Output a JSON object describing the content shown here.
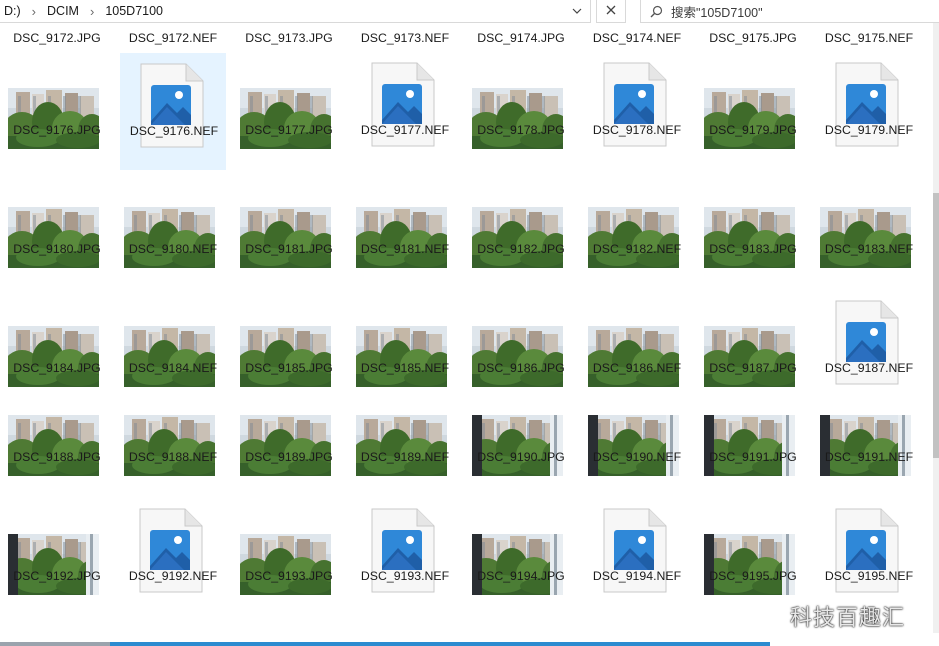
{
  "address": {
    "crumbs": [
      "D:)",
      "DCIM",
      "105D7100"
    ]
  },
  "search": {
    "placeholder": "搜索\"105D7100\""
  },
  "files": [
    {
      "name": "DSC_9172.JPG",
      "kind": "label-only"
    },
    {
      "name": "DSC_9172.NEF",
      "kind": "label-only"
    },
    {
      "name": "DSC_9173.JPG",
      "kind": "label-only"
    },
    {
      "name": "DSC_9173.NEF",
      "kind": "label-only"
    },
    {
      "name": "DSC_9174.JPG",
      "kind": "label-only"
    },
    {
      "name": "DSC_9174.NEF",
      "kind": "label-only"
    },
    {
      "name": "DSC_9175.JPG",
      "kind": "label-only"
    },
    {
      "name": "DSC_9175.NEF",
      "kind": "label-only"
    },
    {
      "name": "DSC_9176.JPG",
      "kind": "photo",
      "scene": "trees"
    },
    {
      "name": "DSC_9176.NEF",
      "kind": "nef",
      "selected": true
    },
    {
      "name": "DSC_9177.JPG",
      "kind": "photo",
      "scene": "trees"
    },
    {
      "name": "DSC_9177.NEF",
      "kind": "nef"
    },
    {
      "name": "DSC_9178.JPG",
      "kind": "photo",
      "scene": "trees"
    },
    {
      "name": "DSC_9178.NEF",
      "kind": "nef"
    },
    {
      "name": "DSC_9179.JPG",
      "kind": "photo",
      "scene": "trees"
    },
    {
      "name": "DSC_9179.NEF",
      "kind": "nef"
    },
    {
      "name": "DSC_9180.JPG",
      "kind": "photo",
      "scene": "trees"
    },
    {
      "name": "DSC_9180.NEF",
      "kind": "photo",
      "scene": "trees"
    },
    {
      "name": "DSC_9181.JPG",
      "kind": "photo",
      "scene": "trees"
    },
    {
      "name": "DSC_9181.NEF",
      "kind": "photo",
      "scene": "trees"
    },
    {
      "name": "DSC_9182.JPG",
      "kind": "photo",
      "scene": "trees"
    },
    {
      "name": "DSC_9182.NEF",
      "kind": "photo",
      "scene": "trees"
    },
    {
      "name": "DSC_9183.JPG",
      "kind": "photo",
      "scene": "trees"
    },
    {
      "name": "DSC_9183.NEF",
      "kind": "photo",
      "scene": "trees"
    },
    {
      "name": "DSC_9184.JPG",
      "kind": "photo",
      "scene": "trees"
    },
    {
      "name": "DSC_9184.NEF",
      "kind": "photo",
      "scene": "trees"
    },
    {
      "name": "DSC_9185.JPG",
      "kind": "photo",
      "scene": "trees"
    },
    {
      "name": "DSC_9185.NEF",
      "kind": "photo",
      "scene": "trees"
    },
    {
      "name": "DSC_9186.JPG",
      "kind": "photo",
      "scene": "trees"
    },
    {
      "name": "DSC_9186.NEF",
      "kind": "photo",
      "scene": "trees"
    },
    {
      "name": "DSC_9187.JPG",
      "kind": "photo",
      "scene": "trees"
    },
    {
      "name": "DSC_9187.NEF",
      "kind": "nef"
    },
    {
      "name": "DSC_9188.JPG",
      "kind": "photo",
      "scene": "trees"
    },
    {
      "name": "DSC_9188.NEF",
      "kind": "photo",
      "scene": "trees"
    },
    {
      "name": "DSC_9189.JPG",
      "kind": "photo",
      "scene": "trees"
    },
    {
      "name": "DSC_9189.NEF",
      "kind": "photo",
      "scene": "trees"
    },
    {
      "name": "DSC_9190.JPG",
      "kind": "photo",
      "scene": "window"
    },
    {
      "name": "DSC_9190.NEF",
      "kind": "photo",
      "scene": "window"
    },
    {
      "name": "DSC_9191.JPG",
      "kind": "photo",
      "scene": "window"
    },
    {
      "name": "DSC_9191.NEF",
      "kind": "photo",
      "scene": "window"
    },
    {
      "name": "DSC_9192.JPG",
      "kind": "photo",
      "scene": "window"
    },
    {
      "name": "DSC_9192.NEF",
      "kind": "nef"
    },
    {
      "name": "DSC_9193.JPG",
      "kind": "photo",
      "scene": "trees"
    },
    {
      "name": "DSC_9193.NEF",
      "kind": "nef"
    },
    {
      "name": "DSC_9194.JPG",
      "kind": "photo",
      "scene": "window"
    },
    {
      "name": "DSC_9194.NEF",
      "kind": "nef"
    },
    {
      "name": "DSC_9195.JPG",
      "kind": "photo",
      "scene": "window"
    },
    {
      "name": "DSC_9195.NEF",
      "kind": "nef"
    }
  ],
  "watermark": "科技百趣汇",
  "colors": {
    "selection": "#e5f3ff",
    "icon_blue": "#2f88d8",
    "icon_dark": "#1f5fa8"
  }
}
